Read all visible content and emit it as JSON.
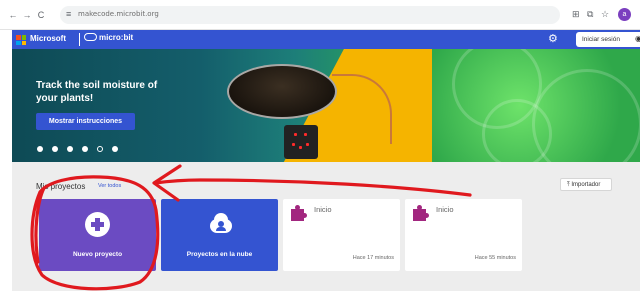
{
  "browser": {
    "url": "makecode.microbit.org",
    "nav": {
      "back": "←",
      "forward": "→",
      "reload": "C"
    },
    "profile_initial": "a"
  },
  "header": {
    "microsoft_label": "Microsoft",
    "microbit_label": "micro:bit",
    "signin_label": "Iniciar sesión"
  },
  "hero": {
    "title": "Track the soil moisture of your plants!",
    "button_label": "Mostrar instrucciones",
    "carousel_total": 6,
    "carousel_active": 4
  },
  "projects": {
    "title": "Mis proyectos",
    "see_all": "Ver todos",
    "import_label": "Importador",
    "new_project": "Nuevo proyecto",
    "cloud_projects": "Proyectos en la nube",
    "items": [
      {
        "name": "Inicio",
        "time": "Hace 17 minutos"
      },
      {
        "name": "Inicio",
        "time": "Hace 55 minutos"
      }
    ]
  },
  "colors": {
    "accent_blue": "#3454d1",
    "new_project_purple": "#6b4bc2",
    "puzzle_magenta": "#a2277f",
    "annotation_red": "#e0191e"
  }
}
